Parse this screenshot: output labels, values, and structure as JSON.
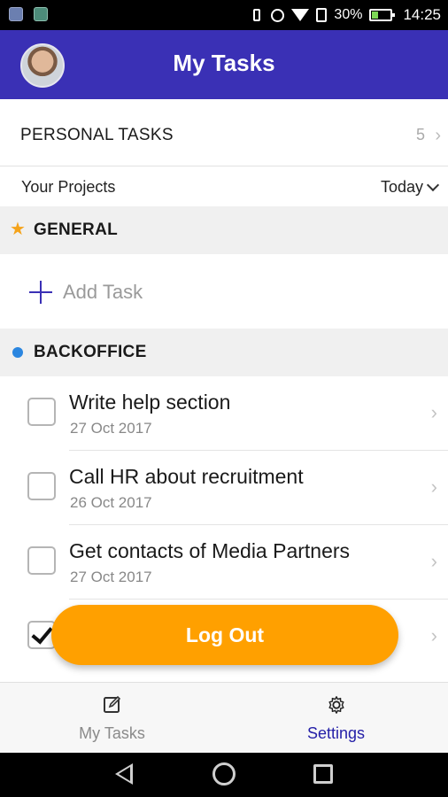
{
  "status_bar": {
    "battery": "30%",
    "time": "14:25"
  },
  "header": {
    "title": "My Tasks"
  },
  "personal_tasks": {
    "label": "PERSONAL TASKS",
    "count": "5"
  },
  "projects": {
    "label": "Your Projects",
    "filter": "Today"
  },
  "sections": [
    {
      "label": "GENERAL",
      "icon": "star-icon",
      "color": "#f5a31a"
    },
    {
      "label": "BACKOFFICE",
      "icon": "dot-icon",
      "color": "#2b86e0"
    }
  ],
  "add_task": {
    "label": "Add Task"
  },
  "tasks": [
    {
      "title": "Write help section",
      "date": "27 Oct 2017",
      "checked": false
    },
    {
      "title": "Call HR about recruitment",
      "date": "26 Oct 2017",
      "checked": false
    },
    {
      "title": "Get contacts of Media Partners",
      "date": "27 Oct 2017",
      "checked": false
    },
    {
      "title": "",
      "date": "",
      "checked": true
    }
  ],
  "logout": {
    "label": "Log Out",
    "color": "#ffa000"
  },
  "tabbar": {
    "tabs": [
      {
        "label": "My Tasks",
        "icon": "edit-icon",
        "active": false
      },
      {
        "label": "Settings",
        "icon": "gear-icon",
        "active": true
      }
    ]
  },
  "theme": {
    "primary": "#3a30b5",
    "accent": "#ffa000"
  }
}
